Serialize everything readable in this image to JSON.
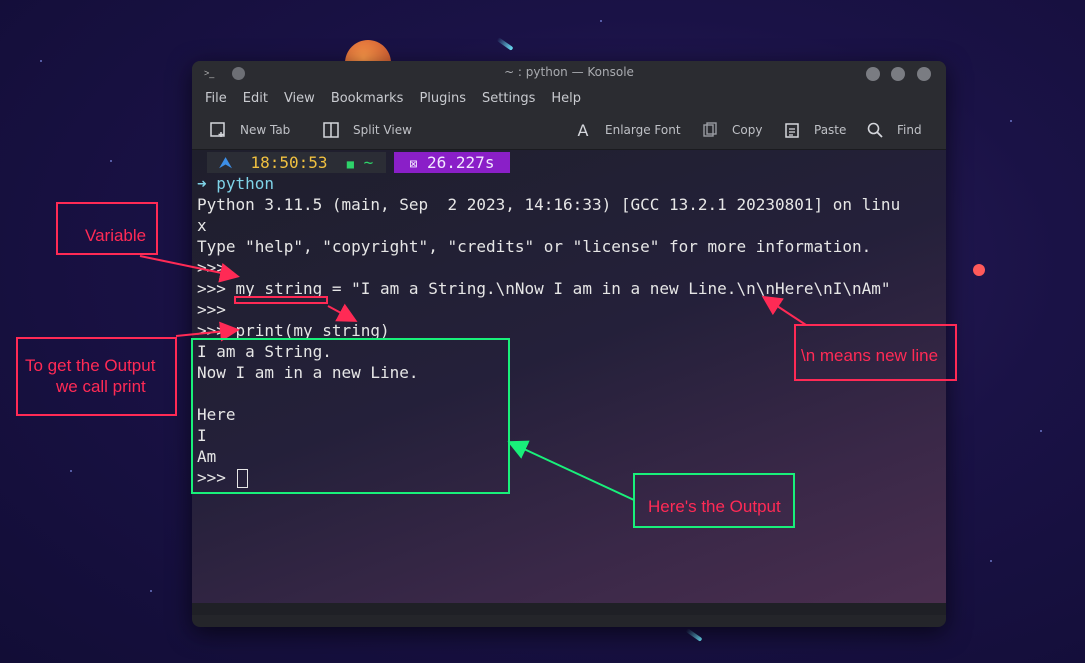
{
  "window": {
    "title": "~ : python — Konsole",
    "menu": [
      "File",
      "Edit",
      "View",
      "Bookmarks",
      "Plugins",
      "Settings",
      "Help"
    ],
    "toolbar": {
      "new_tab": "New Tab",
      "split_view": "Split View",
      "enlarge_font": "Enlarge Font",
      "copy": "Copy",
      "paste": "Paste",
      "find": "Find"
    }
  },
  "prompt": {
    "arch_glyph": "⮝",
    "time": "18:50:53",
    "folder_glyph": "■",
    "dir": "~",
    "timer_glyph": "⊠",
    "duration": "26.227s"
  },
  "terminal": {
    "lines": [
      "➜ python",
      "Python 3.11.5 (main, Sep  2 2023, 14:16:33) [GCC 13.2.1 20230801] on linu",
      "x",
      "Type \"help\", \"copyright\", \"credits\" or \"license\" for more information.",
      ">>>",
      ">>> my_string = \"I am a String.\\nNow I am in a new Line.\\n\\nHere\\nI\\nAm\"",
      ">>>",
      ">>> print(my_string)",
      "I am a String.",
      "Now I am in a new Line.",
      "",
      "Here",
      "I",
      "Am",
      ">>> "
    ]
  },
  "annotations": {
    "variable": "Variable",
    "newline": "\\n means new line",
    "print_hint_1": "To get the Output",
    "print_hint_2": "we call print",
    "output": "Here's the Output"
  },
  "colors": {
    "annotation_red": "#ff2a55",
    "annotation_green": "#19f07a",
    "prompt_time_bg": "#2b2d35",
    "prompt_time_fg": "#f0c040",
    "prompt_dir_fg": "#2ed36a",
    "prompt_duration_bg": "#8a1fc8"
  }
}
